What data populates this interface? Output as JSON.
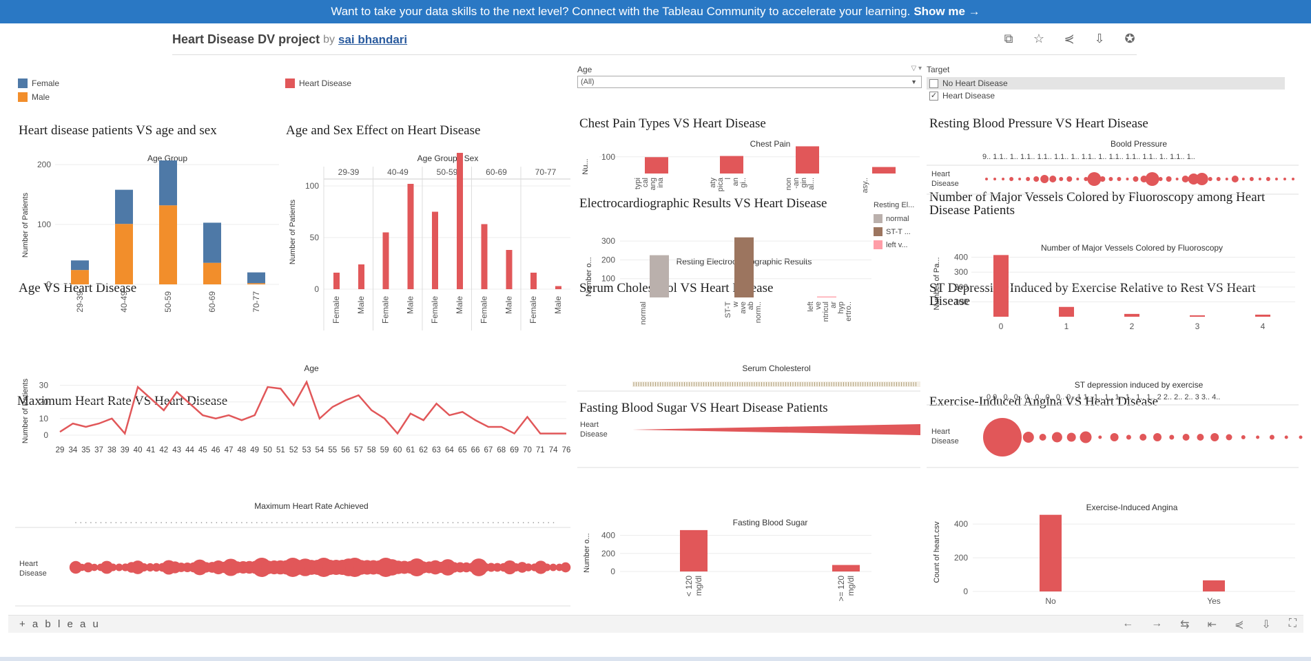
{
  "banner": {
    "text": "Want to take your data skills to the next level? Connect with the Tableau Community to accelerate your learning.",
    "link": "Show me →"
  },
  "header": {
    "title": "Heart Disease DV project",
    "by": "by",
    "author": "sai bhandari"
  },
  "toolbar_icons": [
    "copy-icon",
    "star-icon",
    "share-icon",
    "download-icon",
    "badge-icon"
  ],
  "legend_sex": [
    {
      "label": "Female",
      "color": "#4e79a7"
    },
    {
      "label": "Male",
      "color": "#f28e2b"
    }
  ],
  "legend_hd": {
    "label": "Heart Disease",
    "color": "#e15759"
  },
  "filter_age": {
    "label": "Age",
    "value": "(All)"
  },
  "filter_target": {
    "label": "Target",
    "options": [
      {
        "label": "No Heart Disease",
        "checked": false
      },
      {
        "label": "Heart Disease",
        "checked": true
      }
    ]
  },
  "ecg_legend": {
    "title": "Resting El...",
    "items": [
      {
        "label": "normal",
        "color": "#bab0ac"
      },
      {
        "label": "ST-T ...",
        "color": "#9c755f"
      },
      {
        "label": "left v...",
        "color": "#ff9da7"
      }
    ]
  },
  "charts": {
    "c1": {
      "title": "Heart disease patients VS age and sex"
    },
    "c2": {
      "title": "Age and Sex Effect on Heart Disease"
    },
    "c3": {
      "title": "Chest Pain Types VS Heart Disease"
    },
    "c4": {
      "title": "Resting Blood Pressure VS Heart Disease"
    },
    "c5": {
      "title": "Electrocardiographic Results VS Heart Disease"
    },
    "c6": {
      "title1": "Number of Major Vessels Colored by Fluoroscopy among Heart",
      "title2": "Disease Patients"
    },
    "c7": {
      "title": "Age VS  Heart Disease"
    },
    "c8": {
      "title": "Serum Cholesterol VS Heart Disease"
    },
    "c9": {
      "title1": "ST Depression Induced by Exercise Relative to Rest VS Heart",
      "title2": "Disease"
    },
    "c10": {
      "title": "Maximum Heart Rate VS Heart Disease"
    },
    "c11": {
      "title": "Fasting Blood Sugar VS Heart Disease Patients"
    },
    "c12": {
      "title": "Exercise-Induced Angina VS Heart Disease"
    }
  },
  "chart_data": [
    {
      "id": "c1",
      "type": "bar",
      "title": "Heart disease patients VS age and sex",
      "xlabel": "Age Group",
      "ylabel": "Number of Patients",
      "ylim": [
        0,
        220
      ],
      "yticks": [
        0,
        100,
        200
      ],
      "categories": [
        "29-39",
        "40-49",
        "50-59",
        "60-69",
        "70-77"
      ],
      "series": [
        {
          "name": "Male",
          "color": "#f28e2b",
          "values": [
            24,
            101,
            132,
            36,
            2
          ]
        },
        {
          "name": "Female",
          "color": "#4e79a7",
          "values": [
            16,
            57,
            75,
            67,
            18
          ]
        }
      ]
    },
    {
      "id": "c2",
      "type": "bar",
      "title": "Age and Sex Effect on Heart Disease",
      "xlabel": "Age Group / Sex",
      "ylabel": "Number of Patients",
      "ylim": [
        0,
        140
      ],
      "yticks": [
        0,
        50,
        100
      ],
      "groups": [
        "29-39",
        "40-49",
        "50-59",
        "60-69",
        "70-77"
      ],
      "sub": [
        "Female",
        "Male"
      ],
      "values": [
        [
          16,
          24
        ],
        [
          55,
          102
        ],
        [
          75,
          132
        ],
        [
          63,
          38
        ],
        [
          16,
          3
        ]
      ]
    },
    {
      "id": "c3",
      "type": "bar",
      "title": "Chest Pain Types VS Heart Disease",
      "xlabel": "Chest Pain",
      "ylabel": "Nu...",
      "ylim": [
        0,
        165
      ],
      "yticks": [
        100
      ],
      "categories": [
        "typi cal ang ina",
        "aty pica l an gi..",
        "non -an gin al...",
        "asy.."
      ],
      "values": [
        98,
        105,
        163,
        39
      ]
    },
    {
      "id": "c4",
      "type": "scatter",
      "title": "Resting Blood Pressure VS Heart Disease",
      "xlabel": "Boold Pressure",
      "row_label": "Heart Disease",
      "tick_text": "9.. 1.1.. 1.. 1.1.. 1.1.. 1.1.. 1.. 1.1.. 1.. 1.1.. 1.1.. 1.1.. 1.. 1.1.. 1..",
      "sizes": [
        2,
        2,
        2,
        3,
        2,
        3,
        4,
        6,
        5,
        3,
        4,
        2,
        3,
        10,
        4,
        3,
        3,
        2,
        4,
        5,
        10,
        3,
        4,
        2,
        5,
        8,
        9,
        3,
        3,
        2,
        5,
        2,
        3,
        2,
        3,
        2,
        2,
        2
      ]
    },
    {
      "id": "c5",
      "type": "bar",
      "title": "Electrocardiographic Results VS Heart Disease",
      "xlabel": "Resting Electrocardiographic Results",
      "ylabel": "Number o...",
      "ylim": [
        0,
        330
      ],
      "yticks": [
        100,
        200,
        300
      ],
      "categories": [
        "normal",
        "ST-T w ave ab norm..",
        "left ve ntricul ar hyp ertro.."
      ],
      "values": [
        225,
        320,
        5
      ],
      "colors": [
        "#bab0ac",
        "#9c755f",
        "#ff9da7"
      ]
    },
    {
      "id": "c6",
      "type": "bar",
      "title": "Number of Major Vessels Colored by Fluoroscopy among Heart Disease Patients",
      "xlabel": "Number of Major Vessels Colored by Fluoroscopy",
      "ylabel": "Number of Pa...",
      "ylim": [
        0,
        440
      ],
      "yticks": [
        100,
        200,
        300,
        400
      ],
      "categories": [
        "0",
        "1",
        "2",
        "3",
        "4"
      ],
      "values": [
        415,
        66,
        19,
        6,
        14
      ]
    },
    {
      "id": "c7",
      "type": "line",
      "title": "Age VS  Heart Disease",
      "xlabel": "Age",
      "ylabel": "Number of Patients",
      "ylim": [
        0,
        34
      ],
      "yticks": [
        0,
        10,
        20,
        30
      ],
      "x": [
        "29",
        "34",
        "35",
        "37",
        "38",
        "39",
        "40",
        "41",
        "42",
        "43",
        "44",
        "45",
        "46",
        "47",
        "48",
        "49",
        "50",
        "51",
        "52",
        "53",
        "54",
        "55",
        "56",
        "57",
        "58",
        "59",
        "60",
        "61",
        "62",
        "63",
        "64",
        "65",
        "66",
        "67",
        "68",
        "69",
        "70",
        "71",
        "74",
        "76"
      ],
      "values": [
        2,
        7,
        5,
        7,
        10,
        1,
        29,
        22,
        15,
        26,
        19,
        12,
        10,
        12,
        9,
        12,
        29,
        28,
        18,
        32,
        10,
        17,
        21,
        24,
        15,
        10,
        1,
        13,
        9,
        19,
        12,
        14,
        9,
        5,
        5,
        1,
        11,
        1,
        1,
        1
      ]
    },
    {
      "id": "c8",
      "type": "scatter",
      "title": "Serum Cholesterol VS Heart Disease",
      "xlabel": "Serum Cholesterol",
      "row_label": "Heart Disease"
    },
    {
      "id": "c9",
      "type": "scatter",
      "title": "ST Depression Induced by Exercise Relative to Rest VS Heart Disease",
      "xlabel": "ST depression induced by exercise",
      "row_label": "Heart Disease",
      "tick_text": "0 0.. 0.. 0.. 0.. 0.. 0.. 0.. 0.. 1 1.. 1.. 1.. 1.. 1.. 1.. 1.. 2 2.. 2.. 2.. 3 3.. 4..",
      "sizes": [
        62,
        16,
        10,
        15,
        13,
        17,
        5,
        12,
        7,
        10,
        12,
        7,
        10,
        10,
        12,
        9,
        6,
        5,
        7,
        5,
        5,
        5,
        4
      ]
    },
    {
      "id": "c10",
      "type": "scatter",
      "title": "Maximum Heart Rate VS Heart Disease",
      "xlabel": "Maximum Heart Rate Achieved",
      "row_label": "Heart Disease"
    },
    {
      "id": "c11",
      "type": "bar",
      "title": "Fasting Blood Sugar VS Heart Disease Patients",
      "xlabel": "Fasting Blood Sugar",
      "ylabel": "Number o...",
      "ylim": [
        0,
        480
      ],
      "yticks": [
        0,
        200,
        400
      ],
      "categories": [
        "< 120 mg/dl",
        ">= 120 mg/dl"
      ],
      "values": [
        458,
        72
      ]
    },
    {
      "id": "c12",
      "type": "bar",
      "title": "Exercise-Induced Angina VS Heart Disease",
      "xlabel": "Exercise-Induced Angina",
      "ylabel": "Count of heart.csv",
      "ylim": [
        0,
        470
      ],
      "yticks": [
        0,
        200,
        400
      ],
      "categories": [
        "No",
        "Yes"
      ],
      "values": [
        455,
        66
      ]
    }
  ],
  "footer": {
    "logo": "+ a b l e a u",
    "icons": [
      "undo-icon",
      "redo-icon",
      "revert-icon",
      "dropdown-icon",
      "first-icon",
      "share-icon",
      "download-icon",
      "fullscreen-icon"
    ]
  }
}
